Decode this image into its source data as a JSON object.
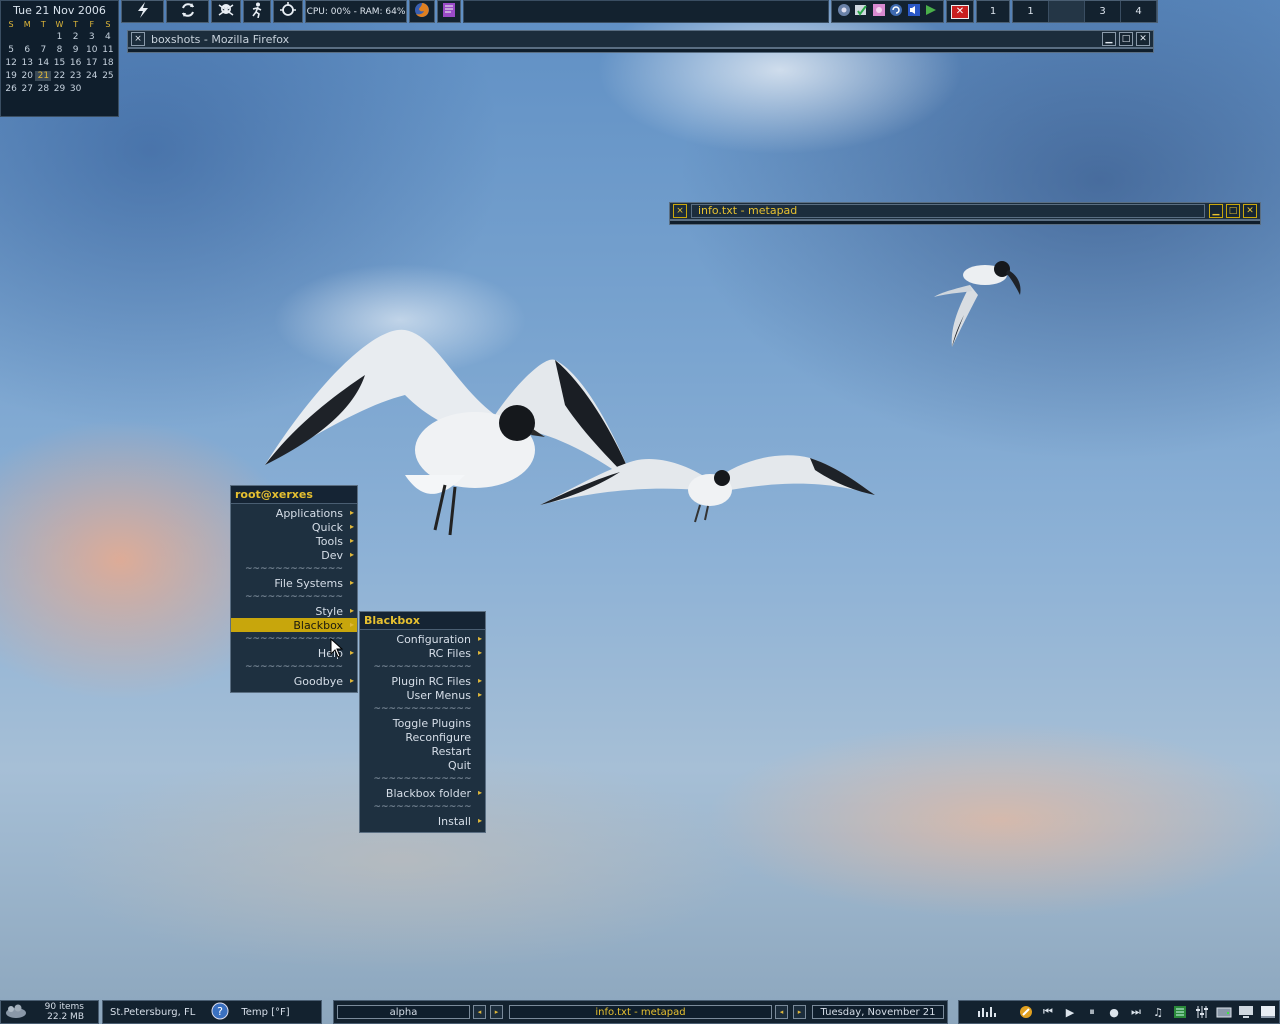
{
  "calendar": {
    "header": "Tue 21 Nov 2006",
    "weekdays": [
      "S",
      "M",
      "T",
      "W",
      "T",
      "F",
      "S"
    ],
    "weeks": [
      [
        "",
        "",
        "",
        "1",
        "2",
        "3",
        "4"
      ],
      [
        "5",
        "6",
        "7",
        "8",
        "9",
        "10",
        "11"
      ],
      [
        "12",
        "13",
        "14",
        "15",
        "16",
        "17",
        "18"
      ],
      [
        "19",
        "20",
        "21",
        "22",
        "23",
        "24",
        "25"
      ],
      [
        "26",
        "27",
        "28",
        "29",
        "30",
        "",
        ""
      ]
    ],
    "today": "21"
  },
  "top_toolbar": {
    "launchers": [
      "bolt-icon",
      "refresh-icon",
      "skull-icon",
      "runner-icon",
      "recycle-icon"
    ],
    "cpu_ram": "CPU: 00% - RAM: 64%",
    "tray_icons": [
      "network-icon",
      "package-check-icon",
      "gimp-icon",
      "update-icon",
      "volume-icon",
      "download-icon"
    ],
    "close_label": "✕",
    "mail_count": "1",
    "workspaces": [
      "1",
      "",
      "3",
      "4"
    ]
  },
  "windows": {
    "firefox": {
      "title": "boxshots - Mozilla Firefox"
    },
    "metapad": {
      "title": "info.txt - metapad"
    }
  },
  "root_menu": {
    "title": "root@xerxes",
    "items": [
      {
        "label": "Applications",
        "sub": true
      },
      {
        "label": "Quick",
        "sub": true
      },
      {
        "label": "Tools",
        "sub": true
      },
      {
        "label": "Dev",
        "sub": true
      },
      {
        "label": "~~~~~~~~~~~~~",
        "sep": true
      },
      {
        "label": "File Systems",
        "sub": true
      },
      {
        "label": "~~~~~~~~~~~~~",
        "sep": true
      },
      {
        "label": "Style",
        "sub": true
      },
      {
        "label": "Blackbox",
        "sub": true,
        "highlight": true
      },
      {
        "label": "~~~~~~~~~~~~~",
        "sep": true
      },
      {
        "label": "Help",
        "sub": true
      },
      {
        "label": "~~~~~~~~~~~~~",
        "sep": true
      },
      {
        "label": "Goodbye",
        "sub": true
      }
    ]
  },
  "blackbox_menu": {
    "title": "Blackbox",
    "items": [
      {
        "label": "Configuration",
        "sub": true
      },
      {
        "label": "RC Files",
        "sub": true
      },
      {
        "label": "~~~~~~~~~~~~~",
        "sep": true
      },
      {
        "label": "Plugin RC Files",
        "sub": true
      },
      {
        "label": "User Menus",
        "sub": true
      },
      {
        "label": "~~~~~~~~~~~~~",
        "sep": true
      },
      {
        "label": "Toggle Plugins"
      },
      {
        "label": "Reconfigure"
      },
      {
        "label": "Restart"
      },
      {
        "label": "Quit"
      },
      {
        "label": "~~~~~~~~~~~~~",
        "sep": true
      },
      {
        "label": "Blackbox folder",
        "sub": true
      },
      {
        "label": "~~~~~~~~~~~~~",
        "sep": true
      },
      {
        "label": "Install",
        "sub": true
      }
    ]
  },
  "bottom_bar": {
    "trash_items": "90 items",
    "trash_size": "22.2 MB",
    "location": "St.Petersburg, FL",
    "temp": "Temp [°F]",
    "workspace_name": "alpha",
    "active_task": "info.txt - metapad",
    "date": "Tuesday, November 21",
    "media_controls": [
      "prev-icon",
      "play-icon",
      "pause-icon",
      "stop-icon",
      "next-icon"
    ]
  },
  "colors": {
    "panel": "#0f1e2c",
    "accent": "#e6c030",
    "highlight": "#c8a60c",
    "border": "#5a6e82"
  }
}
